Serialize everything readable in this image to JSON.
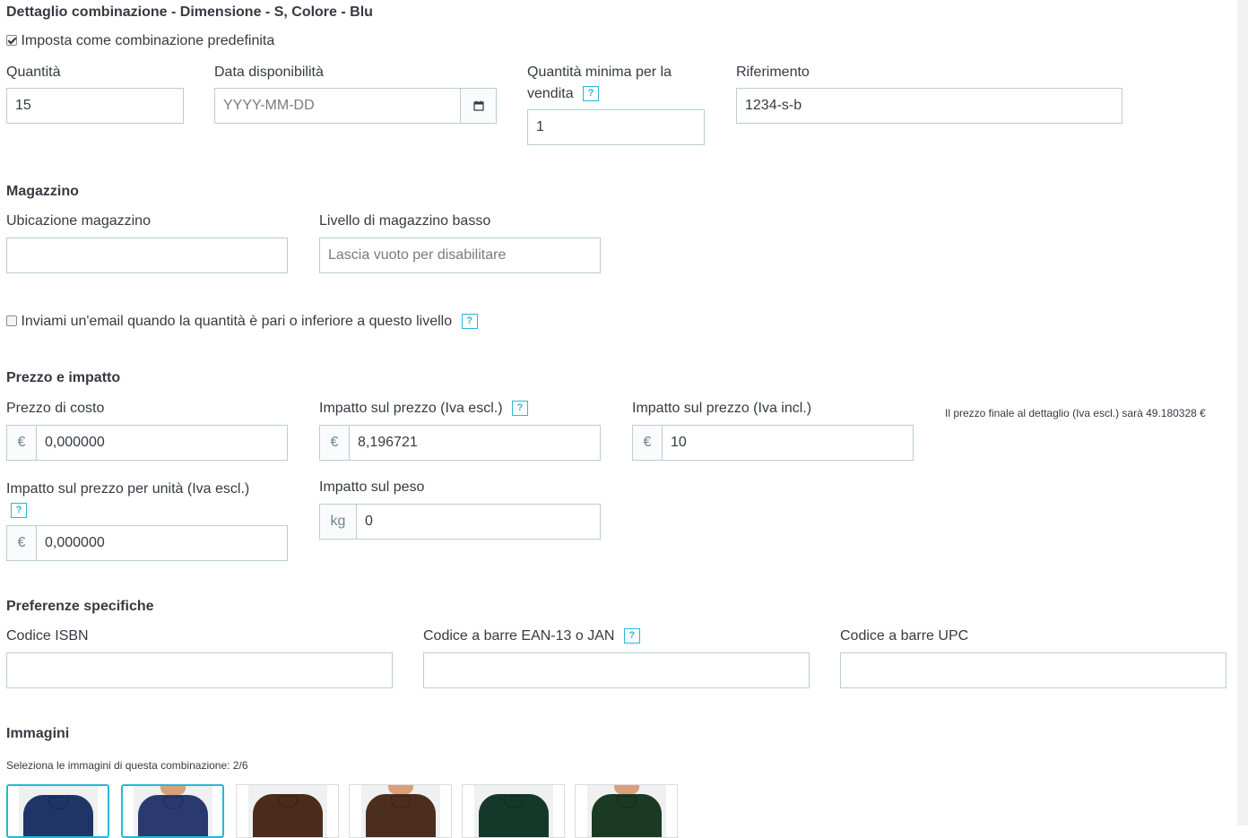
{
  "header": {
    "title": "Dettaglio combinazione - Dimensione - S, Colore - Blu"
  },
  "default_combination": {
    "label": "Imposta come combinazione predefinita",
    "checked": true
  },
  "quantity": {
    "label": "Quantità",
    "value": "15"
  },
  "availability": {
    "label": "Data disponibilità",
    "placeholder": "YYYY-MM-DD",
    "icon": "calendar-icon"
  },
  "min_quantity": {
    "label": "Quantità minima per la vendita",
    "value": "1"
  },
  "reference": {
    "label": "Riferimento",
    "value": "1234-s-b"
  },
  "stock": {
    "title": "Magazzino",
    "location_label": "Ubicazione magazzino",
    "location_value": "",
    "low_level_label": "Livello di magazzino basso",
    "low_level_placeholder": "Lascia vuoto per disabilitare",
    "email_alert_label": "Inviami un'email quando la quantità è pari o inferiore a questo livello",
    "email_alert_checked": false
  },
  "price": {
    "title": "Prezzo e impatto",
    "cost_label": "Prezzo di costo",
    "cost_value": "0,000000",
    "impact_excl_label": "Impatto sul prezzo (Iva escl.)",
    "impact_excl_value": "8,196721",
    "impact_incl_label": "Impatto sul prezzo (Iva incl.)",
    "impact_incl_value": "10",
    "final_price_note": "Il prezzo finale al dettaglio (Iva escl.) sarà 49.180328 €",
    "unit_impact_label": "Impatto sul prezzo per unità (Iva escl.)",
    "unit_impact_value": "0,000000",
    "weight_label": "Impatto sul peso",
    "weight_value": "0",
    "currency_symbol": "€",
    "weight_unit": "kg"
  },
  "specific": {
    "title": "Preferenze specifiche",
    "isbn_label": "Codice ISBN",
    "ean_label": "Codice a barre EAN-13 o JAN",
    "upc_label": "Codice a barre UPC"
  },
  "images": {
    "title": "Immagini",
    "caption": "Seleziona le immagini di questa combinazione: 2/6",
    "items": [
      {
        "color": "#1f3568",
        "selected": true
      },
      {
        "color": "#2a3a70",
        "selected": true
      },
      {
        "color": "#4a2b1c",
        "selected": false
      },
      {
        "color": "#4c2e1f",
        "selected": false
      },
      {
        "color": "#14392a",
        "selected": false
      },
      {
        "color": "#1a3a24",
        "selected": false
      }
    ]
  },
  "help_icon_text": "?",
  "colors": {
    "accent": "#25b9d7",
    "border": "#bbcdd2",
    "text": "#363a41"
  }
}
